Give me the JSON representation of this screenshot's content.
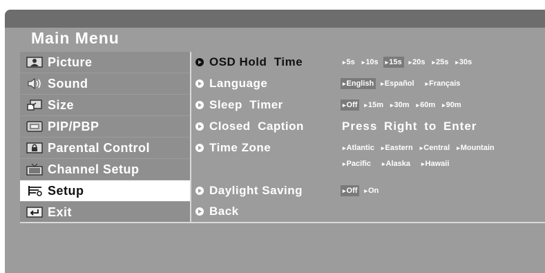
{
  "menu": {
    "title": "Main Menu"
  },
  "sidebar": {
    "items": [
      {
        "label": "Picture",
        "icon": "picture-icon"
      },
      {
        "label": "Sound",
        "icon": "speaker-icon"
      },
      {
        "label": "Size",
        "icon": "resize-icon"
      },
      {
        "label": "PIP/PBP",
        "icon": "pip-icon"
      },
      {
        "label": "Parental Control",
        "icon": "lock-icon"
      },
      {
        "label": "Channel Setup",
        "icon": "tv-icon"
      },
      {
        "label": "Setup",
        "icon": "tools-icon",
        "selected": true
      },
      {
        "label": "Exit",
        "icon": "return-icon"
      }
    ]
  },
  "setup": {
    "osd": {
      "label": "OSD Hold  Time",
      "options": [
        "5s",
        "10s",
        "15s",
        "20s",
        "25s",
        "30s"
      ],
      "selected": "15s"
    },
    "language": {
      "label": "Language",
      "options": [
        "English",
        "Español",
        "Français"
      ],
      "selected": "English"
    },
    "sleep": {
      "label": "Sleep  Timer",
      "options": [
        "Off",
        "15m",
        "30m",
        "60m",
        "90m"
      ],
      "selected": "Off"
    },
    "caption": {
      "label": "Closed  Caption",
      "prompt": "Press Right to Enter"
    },
    "timezone": {
      "label": "Time Zone",
      "options_row1": [
        "Atlantic",
        "Eastern",
        "Central",
        "Mountain"
      ],
      "options_row2": [
        "Pacific",
        "Alaska",
        "Hawaii"
      ]
    },
    "daylight": {
      "label": "Daylight Saving",
      "options": [
        "Off",
        "On"
      ],
      "selected": "Off"
    },
    "back": {
      "label": "Back"
    }
  },
  "colors": {
    "panel": "#9c9c9c",
    "item": "#8f8f8f",
    "highlight": "#7a7a7a",
    "selected_bg": "#ffffff"
  }
}
